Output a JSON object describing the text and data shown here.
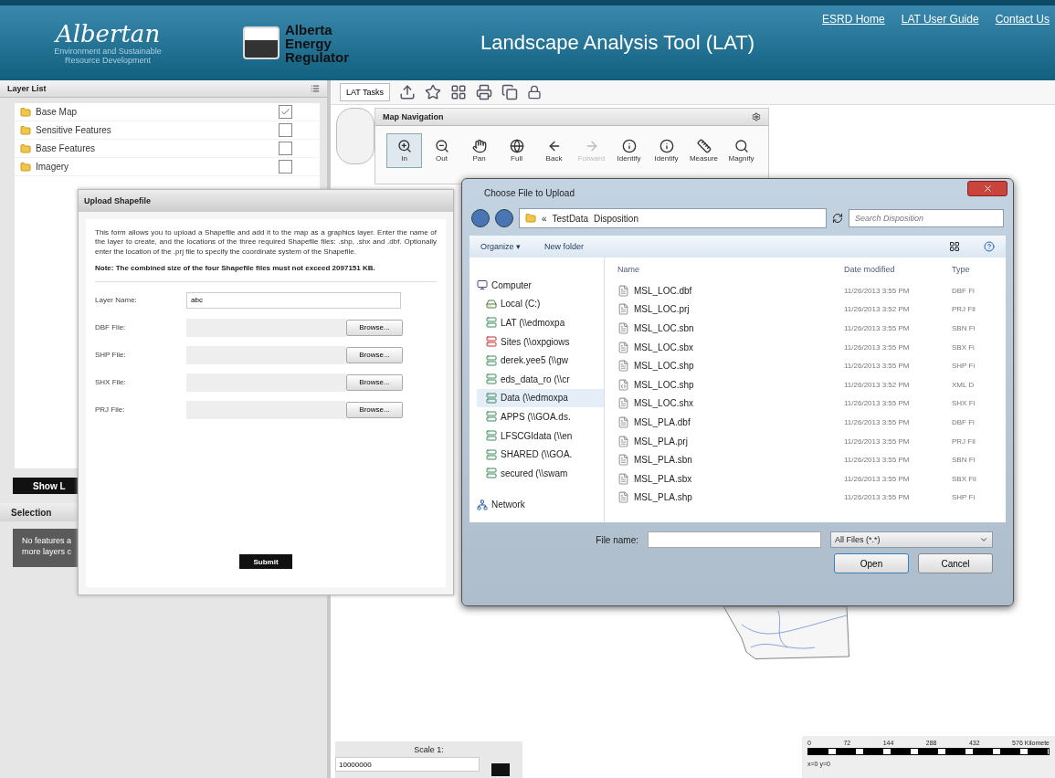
{
  "header": {
    "logo": "Albertan",
    "ministry": "Environment and Sustainable Resource Development",
    "regulator": "Alberta Energy Regulator",
    "title": "Landscape Analysis Tool (LAT)",
    "links": [
      "ESRD Home",
      "LAT User Guide",
      "Contact Us"
    ]
  },
  "layer_list": {
    "title": "Layer List",
    "items": [
      {
        "label": "Base Map",
        "checked": true
      },
      {
        "label": "Sensitive Features",
        "checked": false
      },
      {
        "label": "Base Features",
        "checked": false
      },
      {
        "label": "Imagery",
        "checked": false
      }
    ],
    "show_button": "Show L"
  },
  "selection": {
    "title": "Selection",
    "message": "No features a more layers c"
  },
  "toolbar": {
    "tasks": "LAT Tasks"
  },
  "map_navigation": {
    "title": "Map Navigation",
    "tools": [
      {
        "kind": "zoom-in",
        "label": "In",
        "selected": true,
        "disabled": false
      },
      {
        "kind": "zoom-out",
        "label": "Out",
        "selected": false,
        "disabled": false
      },
      {
        "kind": "pan",
        "label": "Pan",
        "selected": false,
        "disabled": false
      },
      {
        "kind": "full",
        "label": "Full",
        "selected": false,
        "disabled": false
      },
      {
        "kind": "back",
        "label": "Back",
        "selected": false,
        "disabled": false
      },
      {
        "kind": "forward",
        "label": "Forward",
        "selected": false,
        "disabled": true
      },
      {
        "kind": "identify",
        "label": "Identify",
        "selected": false,
        "disabled": false
      },
      {
        "kind": "identify",
        "label": "Identify",
        "selected": false,
        "disabled": false
      },
      {
        "kind": "measure",
        "label": "Measure",
        "selected": false,
        "disabled": false
      },
      {
        "kind": "magnify",
        "label": "Magnify",
        "selected": false,
        "disabled": false
      }
    ]
  },
  "upload_dialog": {
    "title": "Upload Shapefile",
    "intro": "This form allows you to upload a Shapefile and add it to the map as a graphics layer. Enter the name of the layer to create, and the locations of the three required Shapefile files: .shp, .shx and .dbf. Optionally enter the location of the .prj file to specify the coordinate system of the Shapefile.",
    "note": "Note: The combined size of the four Shapefile files must not exceed 2097151 KB.",
    "layer_name": {
      "label": "Layer Name:",
      "value": "abc"
    },
    "files": [
      {
        "label": "DBF File:",
        "button": "Browse..."
      },
      {
        "label": "SHP File:",
        "button": "Browse..."
      },
      {
        "label": "SHX File:",
        "button": "Browse..."
      },
      {
        "label": "PRJ File:",
        "button": "Browse..."
      }
    ],
    "submit": "Submit"
  },
  "file_dialog": {
    "title": "Choose File to Upload",
    "path": [
      "«",
      "TestData",
      "Disposition"
    ],
    "search": {
      "placeholder": "Search Disposition"
    },
    "organize": "Organize ▾",
    "new_folder": "New folder",
    "nav": [
      {
        "kind": "computer",
        "label": "Computer",
        "selected": false
      },
      {
        "kind": "drive",
        "label": "Local (C:)",
        "selected": false
      },
      {
        "kind": "share",
        "label": "LAT (\\\\edmoxpa",
        "selected": false
      },
      {
        "kind": "share-off",
        "label": "Sites (\\\\oxpgiows",
        "selected": false
      },
      {
        "kind": "share",
        "label": "derek.yee5 (\\\\gw",
        "selected": false
      },
      {
        "kind": "share",
        "label": "eds_data_ro (\\\\cr",
        "selected": false
      },
      {
        "kind": "share",
        "label": "Data (\\\\edmoxpa",
        "selected": true
      },
      {
        "kind": "share",
        "label": "APPS (\\\\GOA.ds.",
        "selected": false
      },
      {
        "kind": "share",
        "label": "LFSCGIdata (\\\\en",
        "selected": false
      },
      {
        "kind": "share",
        "label": "SHARED (\\\\GOA.",
        "selected": false
      },
      {
        "kind": "share",
        "label": "secured (\\\\swam",
        "selected": false
      },
      {
        "kind": "network",
        "label": "Network",
        "selected": false
      }
    ],
    "columns": [
      "Name",
      "Date modified",
      "Type"
    ],
    "rows": [
      {
        "kind": "file",
        "name": "MSL_LOC.dbf",
        "date": "11/26/2013 3:55 PM",
        "type": "DBF Fi"
      },
      {
        "kind": "file",
        "name": "MSL_LOC.prj",
        "date": "11/26/2013 3:52 PM",
        "type": "PRJ Fil"
      },
      {
        "kind": "file",
        "name": "MSL_LOC.sbn",
        "date": "11/26/2013 3:55 PM",
        "type": "SBN Fi"
      },
      {
        "kind": "file",
        "name": "MSL_LOC.sbx",
        "date": "11/26/2013 3:55 PM",
        "type": "SBX Fi"
      },
      {
        "kind": "file",
        "name": "MSL_LOC.shp",
        "date": "11/26/2013 3:55 PM",
        "type": "SHP Fi"
      },
      {
        "kind": "xml",
        "name": "MSL_LOC.shp",
        "date": "11/26/2013 3:52 PM",
        "type": "XML D"
      },
      {
        "kind": "file",
        "name": "MSL_LOC.shx",
        "date": "11/26/2013 3:55 PM",
        "type": "SHX Fi"
      },
      {
        "kind": "file",
        "name": "MSL_PLA.dbf",
        "date": "11/26/2013 3:55 PM",
        "type": "DBF Fi"
      },
      {
        "kind": "file",
        "name": "MSL_PLA.prj",
        "date": "11/26/2013 3:55 PM",
        "type": "PRJ Fil"
      },
      {
        "kind": "file",
        "name": "MSL_PLA.sbn",
        "date": "11/26/2013 3:55 PM",
        "type": "SBN Fi"
      },
      {
        "kind": "file",
        "name": "MSL_PLA.sbx",
        "date": "11/26/2013 3:55 PM",
        "type": "SBX Fil"
      },
      {
        "kind": "file",
        "name": "MSL_PLA.shp",
        "date": "11/26/2013 3:55 PM",
        "type": "SHP Fi"
      }
    ],
    "file_name_label": "File name:",
    "filter": "All Files (*.*)",
    "open": "Open",
    "cancel": "Cancel"
  },
  "scale": {
    "label": "Scale 1:",
    "value": "10000000"
  },
  "scale_bar": {
    "ticks": [
      "0",
      "72",
      "144",
      "288",
      "432",
      "576 Kilomete"
    ],
    "coords": "x=0 y=0"
  }
}
